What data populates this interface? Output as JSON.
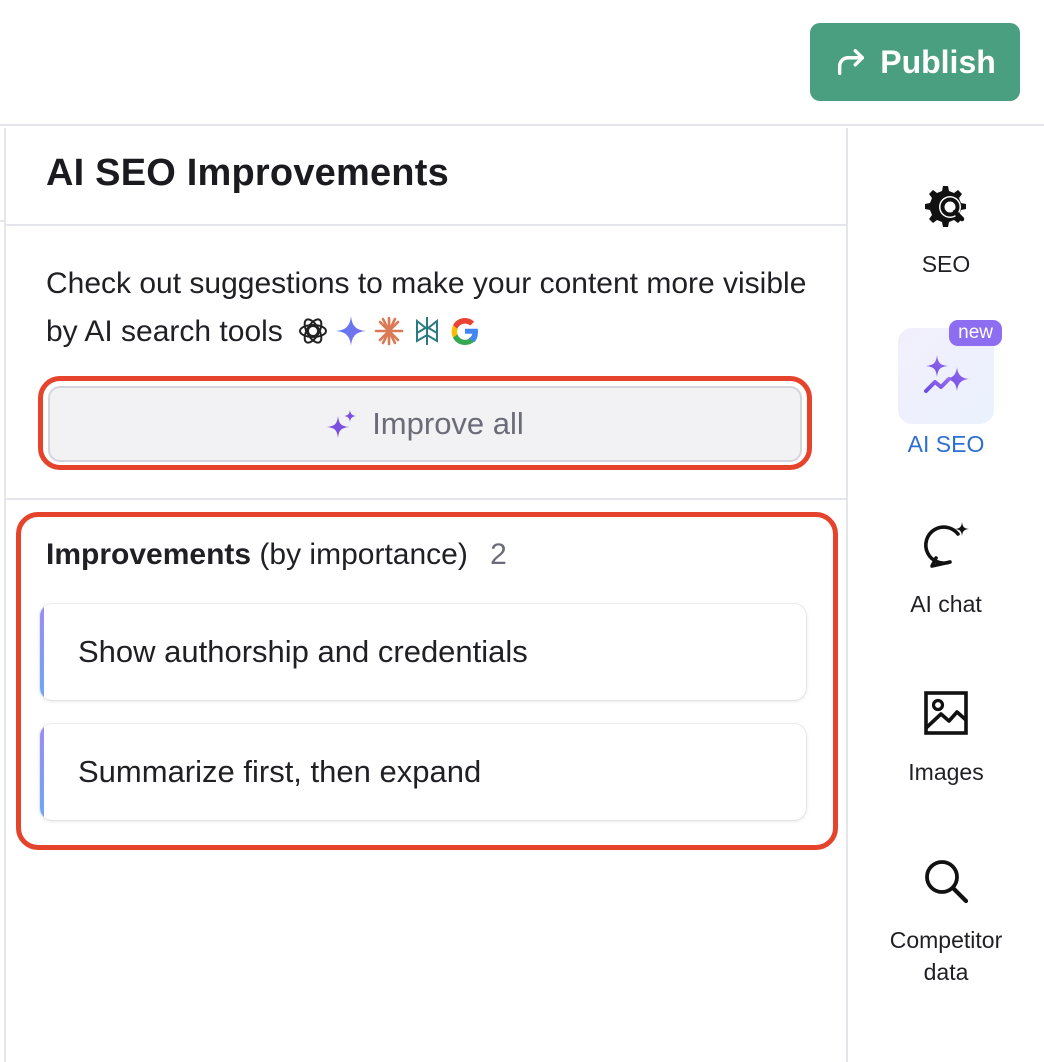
{
  "toolbar": {
    "publish_label": "Publish"
  },
  "panel": {
    "title": "AI SEO Improvements",
    "description": "Check out suggestions to make your content more visible by AI search tools",
    "ai_tool_icons": [
      "openai-icon",
      "gemini-icon",
      "claude-icon",
      "perplexity-icon",
      "google-icon"
    ],
    "improve_all_label": "Improve all",
    "improvements_heading_bold": "Improvements",
    "improvements_heading_rest": "(by importance)",
    "improvements_count": "2",
    "improvements": [
      {
        "label": "Show authorship and credentials"
      },
      {
        "label": "Summarize first, then expand"
      }
    ]
  },
  "sidebar": {
    "items": [
      {
        "label": "SEO",
        "icon": "seo-gear-icon"
      },
      {
        "label": "AI SEO",
        "icon": "sparkles-icon",
        "badge": "new",
        "active": true
      },
      {
        "label": "AI chat",
        "icon": "chat-sparkle-icon"
      },
      {
        "label": "Images",
        "icon": "image-icon"
      },
      {
        "label": "Competitor",
        "label_line2": "data",
        "icon": "magnifier-icon"
      }
    ]
  },
  "colors": {
    "publish_bg": "#4a9f80",
    "highlight_outline": "#e5432b",
    "ai_seo_active": "#2f6fd1",
    "badge_bg": "#8d6df0"
  }
}
